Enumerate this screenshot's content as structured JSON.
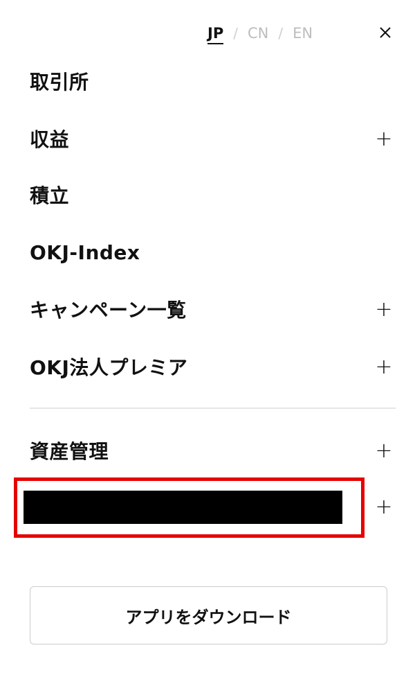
{
  "languages": [
    {
      "label": "JP",
      "active": true
    },
    {
      "label": "CN",
      "active": false
    },
    {
      "label": "EN",
      "active": false
    }
  ],
  "separator": "/",
  "icons": {
    "close": "close-icon",
    "expand": "plus-icon"
  },
  "menu": {
    "items": [
      {
        "label": "取引所",
        "expandable": false
      },
      {
        "label": "収益",
        "expandable": true
      },
      {
        "label": "積立",
        "expandable": false
      },
      {
        "label": "OKJ-Index",
        "expandable": false
      },
      {
        "label": "キャンペーン一覧",
        "expandable": true
      },
      {
        "label": "OKJ法人プレミア",
        "expandable": true
      }
    ],
    "secondary": [
      {
        "label": "資産管理",
        "expandable": true
      }
    ],
    "plus_symbol": "+"
  },
  "highlight_color": "#e60000",
  "download_button": {
    "label": "アプリをダウンロード"
  }
}
